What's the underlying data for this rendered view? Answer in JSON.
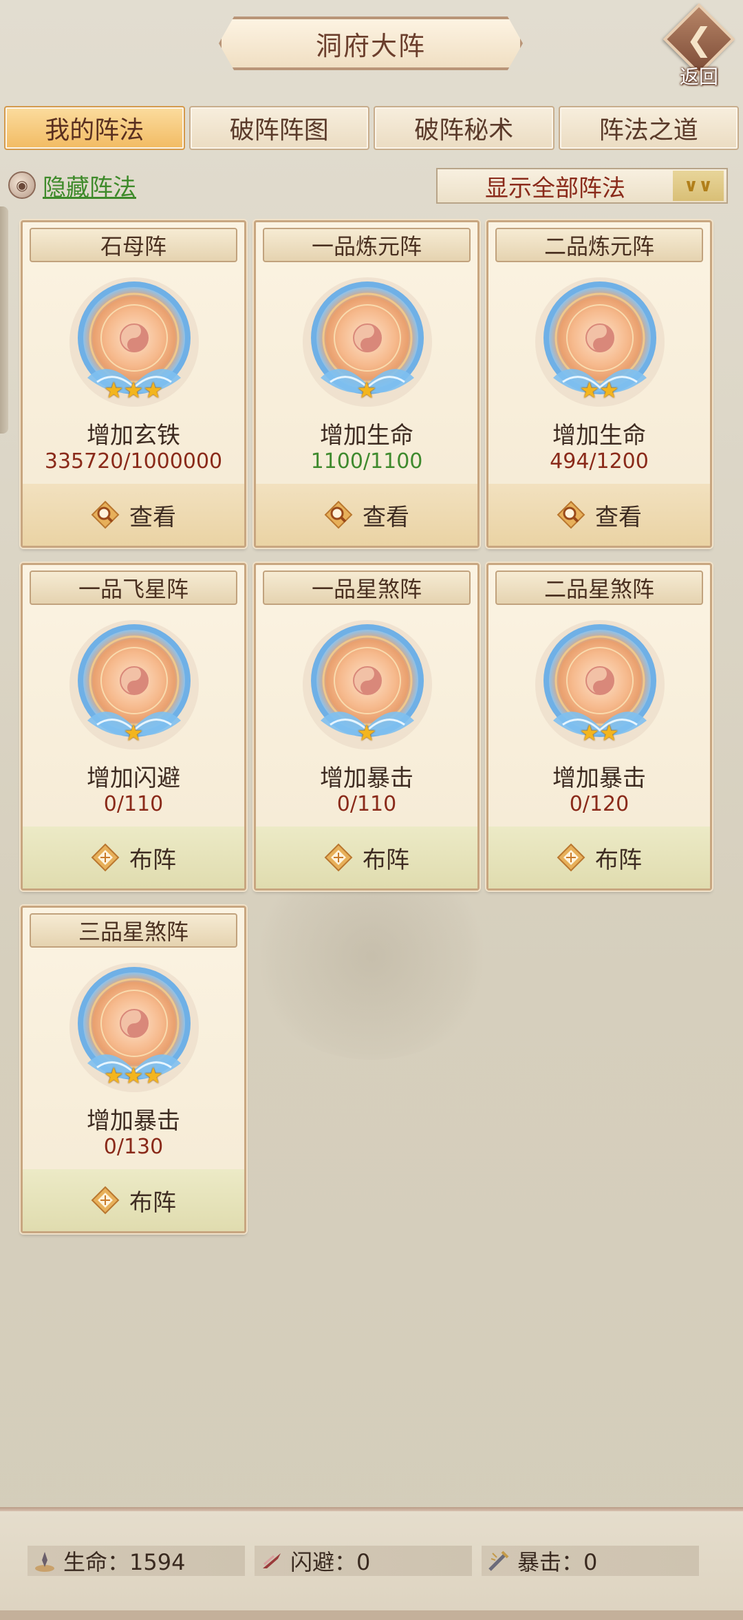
{
  "header": {
    "title": "洞府大阵",
    "back_label": "返回"
  },
  "tabs": [
    {
      "label": "我的阵法",
      "active": true
    },
    {
      "label": "破阵阵图",
      "active": false
    },
    {
      "label": "破阵秘术",
      "active": false
    },
    {
      "label": "阵法之道",
      "active": false
    }
  ],
  "filter": {
    "hide_label": "隐藏阵法",
    "select_value": "显示全部阵法"
  },
  "formations": [
    {
      "name": "石母阵",
      "stars": 3,
      "attr": "增加玄铁",
      "value": "335720/1000000",
      "value_color": "red",
      "action": "查看",
      "action_type": "view"
    },
    {
      "name": "一品炼元阵",
      "stars": 1,
      "attr": "增加生命",
      "value": "1100/1100",
      "value_color": "green",
      "action": "查看",
      "action_type": "view"
    },
    {
      "name": "二品炼元阵",
      "stars": 2,
      "attr": "增加生命",
      "value": "494/1200",
      "value_color": "red",
      "action": "查看",
      "action_type": "view"
    },
    {
      "name": "一品飞星阵",
      "stars": 1,
      "attr": "增加闪避",
      "value": "0/110",
      "value_color": "red",
      "action": "布阵",
      "action_type": "deploy"
    },
    {
      "name": "一品星煞阵",
      "stars": 1,
      "attr": "增加暴击",
      "value": "0/110",
      "value_color": "red",
      "action": "布阵",
      "action_type": "deploy"
    },
    {
      "name": "二品星煞阵",
      "stars": 2,
      "attr": "增加暴击",
      "value": "0/120",
      "value_color": "red",
      "action": "布阵",
      "action_type": "deploy"
    },
    {
      "name": "三品星煞阵",
      "stars": 3,
      "attr": "增加暴击",
      "value": "0/130",
      "value_color": "red",
      "action": "布阵",
      "action_type": "deploy"
    }
  ],
  "stats": [
    {
      "label": "生命：1594",
      "icon": "life-icon"
    },
    {
      "label": "闪避：0",
      "icon": "dodge-icon"
    },
    {
      "label": "暴击：0",
      "icon": "crit-icon"
    }
  ],
  "colors": {
    "value_red": "#8a2a1a",
    "value_green": "#3f8a2e",
    "tab_active": "#f2bb63",
    "link_green": "#3e8a2a"
  }
}
